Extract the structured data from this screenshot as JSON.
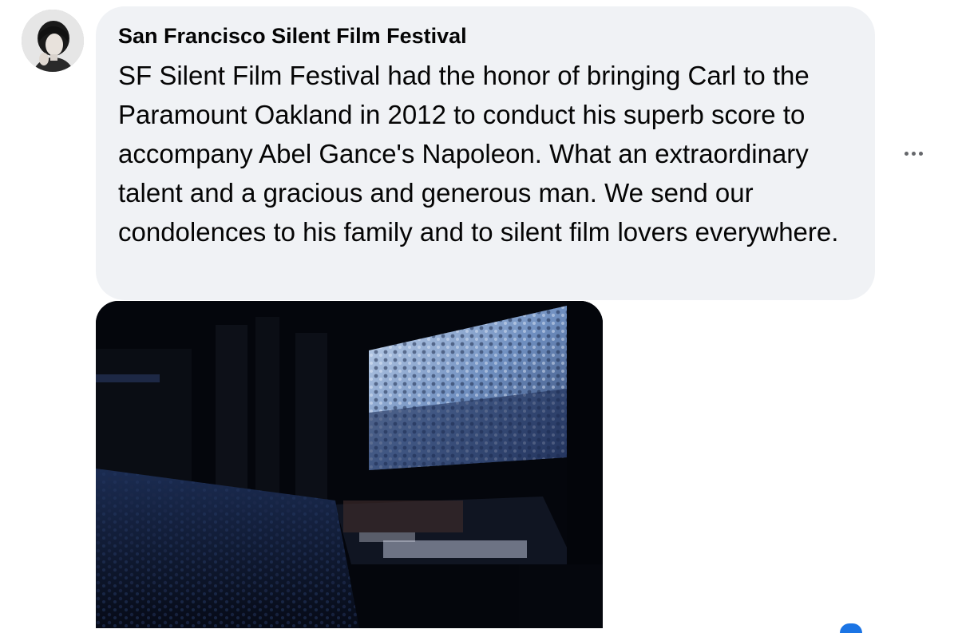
{
  "comment": {
    "author": "San Francisco Silent Film Festival",
    "text": "SF Silent Film Festival had the honor of bringing Carl to the Paramount Oakland in 2012 to conduct his superb score to accompany Abel Gance's Napoleon. What an extraordinary talent and a gracious and generous man. We send our condolences to his family and to silent film lovers everywhere.",
    "avatar_icon": "profile-photo",
    "more_icon": "more-options-icon",
    "attachment_icon": "photo-attachment",
    "reaction_icon": "reaction-icon"
  },
  "colors": {
    "bubble_bg": "#f0f2f5",
    "text": "#050505",
    "icon_gray": "#65676b",
    "reaction_blue": "#1b74e4"
  }
}
